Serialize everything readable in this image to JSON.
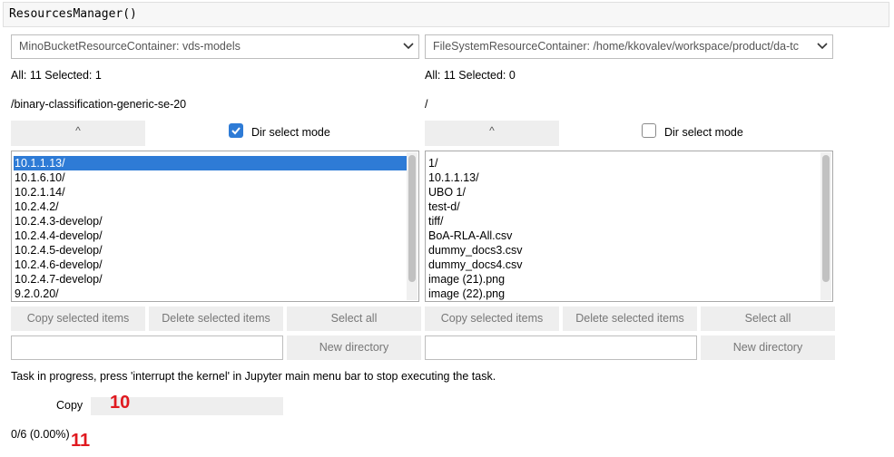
{
  "code_cell": {
    "text": "ResourcesManager()"
  },
  "left": {
    "container_select": "MinoBucketResourceContainer: vds-models",
    "counts": "All: 11 Selected: 1",
    "path": "/binary-classification-generic-se-20",
    "up_button": "^",
    "dir_select_label": "Dir select mode",
    "dir_select_checked": true,
    "items": [
      "10.1.1.13/",
      "10.1.6.10/",
      "10.2.1.14/",
      "10.2.4.2/",
      "10.2.4.3-develop/",
      "10.2.4.4-develop/",
      "10.2.4.5-develop/",
      "10.2.4.6-develop/",
      "10.2.4.7-develop/",
      "9.2.0.20/"
    ],
    "selected_item": "10.1.1.13/",
    "copy_label": "Copy selected items",
    "delete_label": "Delete selected items",
    "select_all_label": "Select all",
    "new_dir_label": "New directory",
    "new_dir_value": ""
  },
  "right": {
    "container_select": "FileSystemResourceContainer: /home/kkovalev/workspace/product/da-tc",
    "counts": "All: 11 Selected: 0",
    "path": "/",
    "up_button": "^",
    "dir_select_label": "Dir select mode",
    "dir_select_checked": false,
    "items": [
      "1/",
      "10.1.1.13/",
      "UBO 1/",
      "test-d/",
      "tiff/",
      "BoA-RLA-All.csv",
      "dummy_docs3.csv",
      "dummy_docs4.csv",
      "image (21).png",
      "image (22).png"
    ],
    "copy_label": "Copy selected items",
    "delete_label": "Delete selected items",
    "select_all_label": "Select all",
    "new_dir_label": "New directory",
    "new_dir_value": ""
  },
  "task": {
    "message": "Task in progress, press 'interrupt the kernel' in Jupyter main menu bar to stop executing the task.",
    "progress_label": "Copy",
    "progress_fraction": 0.0,
    "progress_text": "0/6 (0.00%)"
  },
  "annotations": {
    "mark_a": "10",
    "mark_b": "11",
    "color": "#e0191f"
  },
  "colors": {
    "selection": "#2e7bd6",
    "button_bg": "#eeeeee"
  },
  "icons": {
    "dropdown": "chevron-down-icon",
    "check": "checkmark-icon"
  }
}
